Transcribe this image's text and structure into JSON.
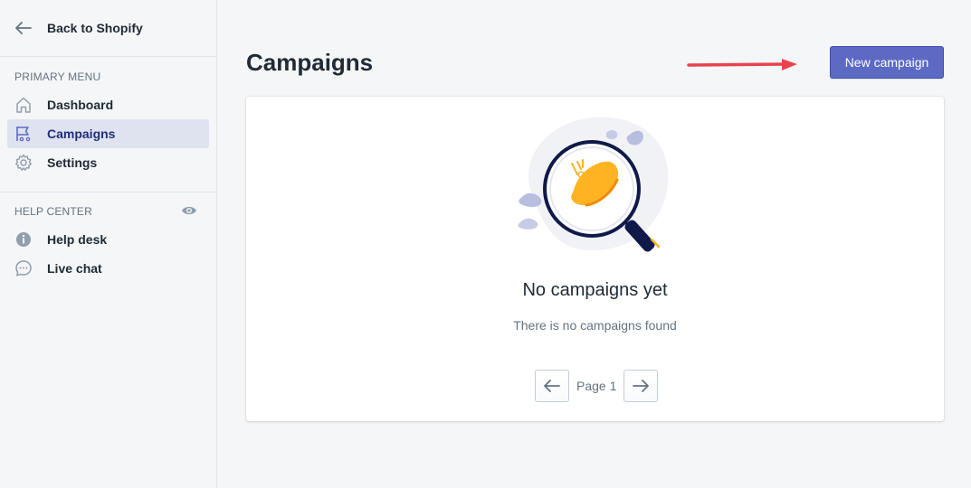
{
  "sidebar": {
    "back_label": "Back to Shopify",
    "primary_title": "PRIMARY MENU",
    "primary_items": [
      {
        "label": "Dashboard",
        "icon": "home-icon"
      },
      {
        "label": "Campaigns",
        "icon": "flag-icon",
        "active": true
      },
      {
        "label": "Settings",
        "icon": "gear-icon"
      }
    ],
    "help_title": "HELP CENTER",
    "help_items": [
      {
        "label": "Help desk",
        "icon": "info-icon"
      },
      {
        "label": "Live chat",
        "icon": "chat-icon"
      }
    ]
  },
  "header": {
    "title": "Campaigns",
    "new_button_label": "New campaign"
  },
  "empty_state": {
    "title": "No campaigns yet",
    "subtitle": "There is no campaigns found"
  },
  "pagination": {
    "label": "Page 1"
  },
  "colors": {
    "accent": "#5c6ac4",
    "annotation_arrow": "#e8434d",
    "illustration_orange": "#ffb320"
  }
}
